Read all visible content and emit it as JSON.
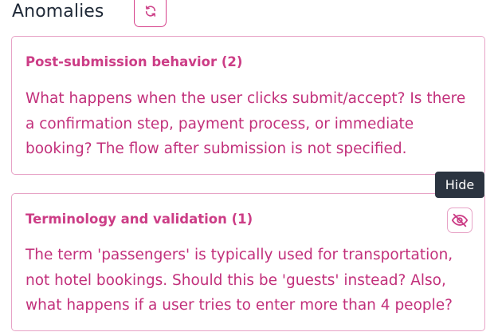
{
  "section": {
    "title": "Anomalies",
    "refresh_icon": "refresh-icon"
  },
  "cards": [
    {
      "title": "Post-submission behavior (2)",
      "body": "What happens when the user clicks submit/accept? Is there a confirmation step, payment process, or immediate booking? The flow after submission is not specified."
    },
    {
      "title": "Terminology and validation (1)",
      "body": "The term 'passengers' is typically used for transportation, not hotel bookings. Should this be 'guests' instead? Also, what happens if a user tries to enter more than 4 people?",
      "hide_icon": "eye-slash-icon"
    }
  ],
  "tooltip": {
    "label": "Hide"
  },
  "colors": {
    "accent": "#cc3d86",
    "card_border": "#e7a3c6",
    "tooltip_bg": "#2b3440",
    "heading": "#1f2937"
  }
}
